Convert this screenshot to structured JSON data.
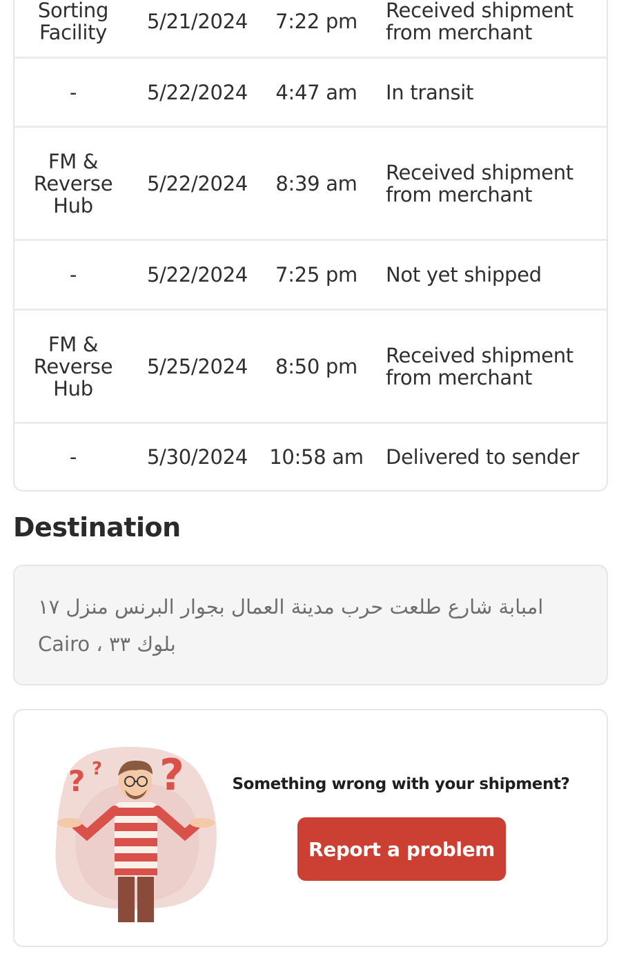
{
  "tracking": {
    "rows": [
      {
        "location": "Sorting Facility",
        "date": "5/21/2024",
        "time": "7:22 pm",
        "status": "Received shipment from merchant"
      },
      {
        "location": "-",
        "date": "5/22/2024",
        "time": "4:47 am",
        "status": "In transit"
      },
      {
        "location": "FM & Reverse Hub",
        "date": "5/22/2024",
        "time": "8:39 am",
        "status": "Received shipment from merchant"
      },
      {
        "location": "-",
        "date": "5/22/2024",
        "time": "7:25 pm",
        "status": "Not yet shipped"
      },
      {
        "location": "FM & Reverse Hub",
        "date": "5/25/2024",
        "time": "8:50 pm",
        "status": "Received shipment from merchant"
      },
      {
        "location": "-",
        "date": "5/30/2024",
        "time": "10:58 am",
        "status": "Delivered to sender"
      }
    ]
  },
  "destination": {
    "title": "Destination",
    "address": "امبابة شارع طلعت حرب مدينة العمال بجوار البرنس منزل ١٧ بلوك ٣٣ ، Cairo"
  },
  "help": {
    "question": "Something wrong with your shipment?",
    "button_label": "Report a problem",
    "illustration_icon": "confused-person-illustration"
  },
  "colors": {
    "accent": "#cc3f33",
    "border": "#e6e6e6",
    "address_bg": "#f5f5f5"
  }
}
